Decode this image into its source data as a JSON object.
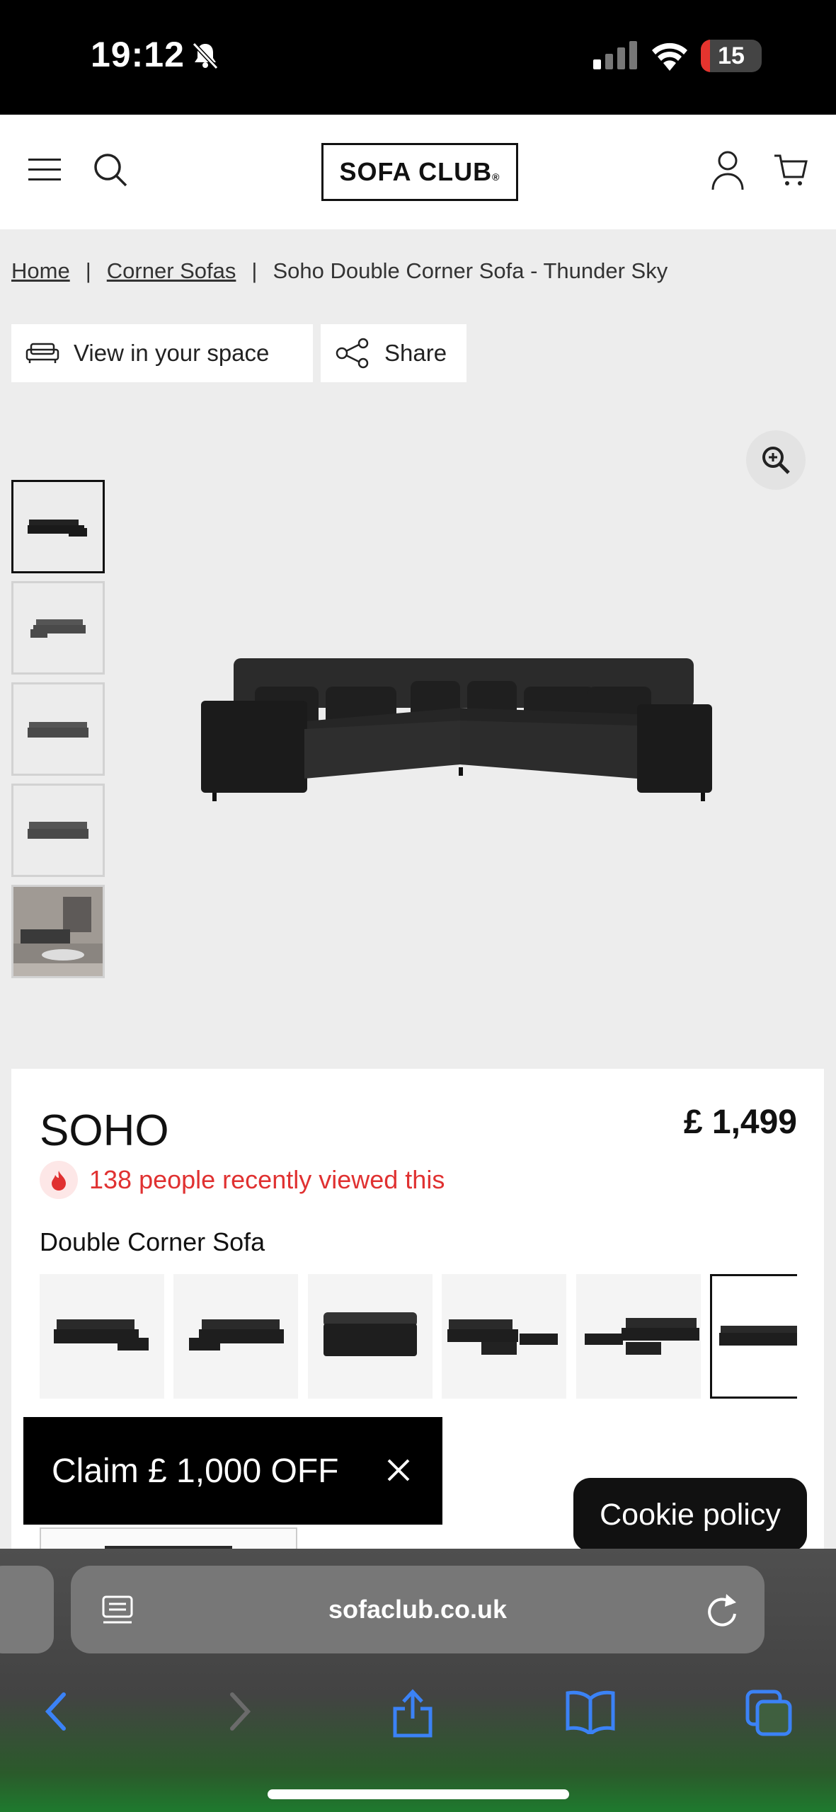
{
  "status_bar": {
    "time": "19:12",
    "battery": "15",
    "battery_level": 0.15
  },
  "header": {
    "logo": "SOFA CLUB",
    "logo_mark": "®"
  },
  "breadcrumb": {
    "home": "Home",
    "category": "Corner Sofas",
    "current": "Soho Double Corner Sofa - Thunder Sky",
    "separator": "|"
  },
  "actions": {
    "view_in_space": "View in your space",
    "share": "Share"
  },
  "product": {
    "name": "SOHO",
    "price": "£ 1,499",
    "recently_viewed": "138 people recently viewed this",
    "variant_label": "Double Corner Sofa"
  },
  "promo": {
    "claim": "Claim £ 1,000 OFF"
  },
  "cookie": {
    "label": "Cookie policy"
  },
  "browser": {
    "url": "sofaclub.co.uk"
  },
  "colors": {
    "accent_red": "#e03131",
    "black": "#000000"
  }
}
